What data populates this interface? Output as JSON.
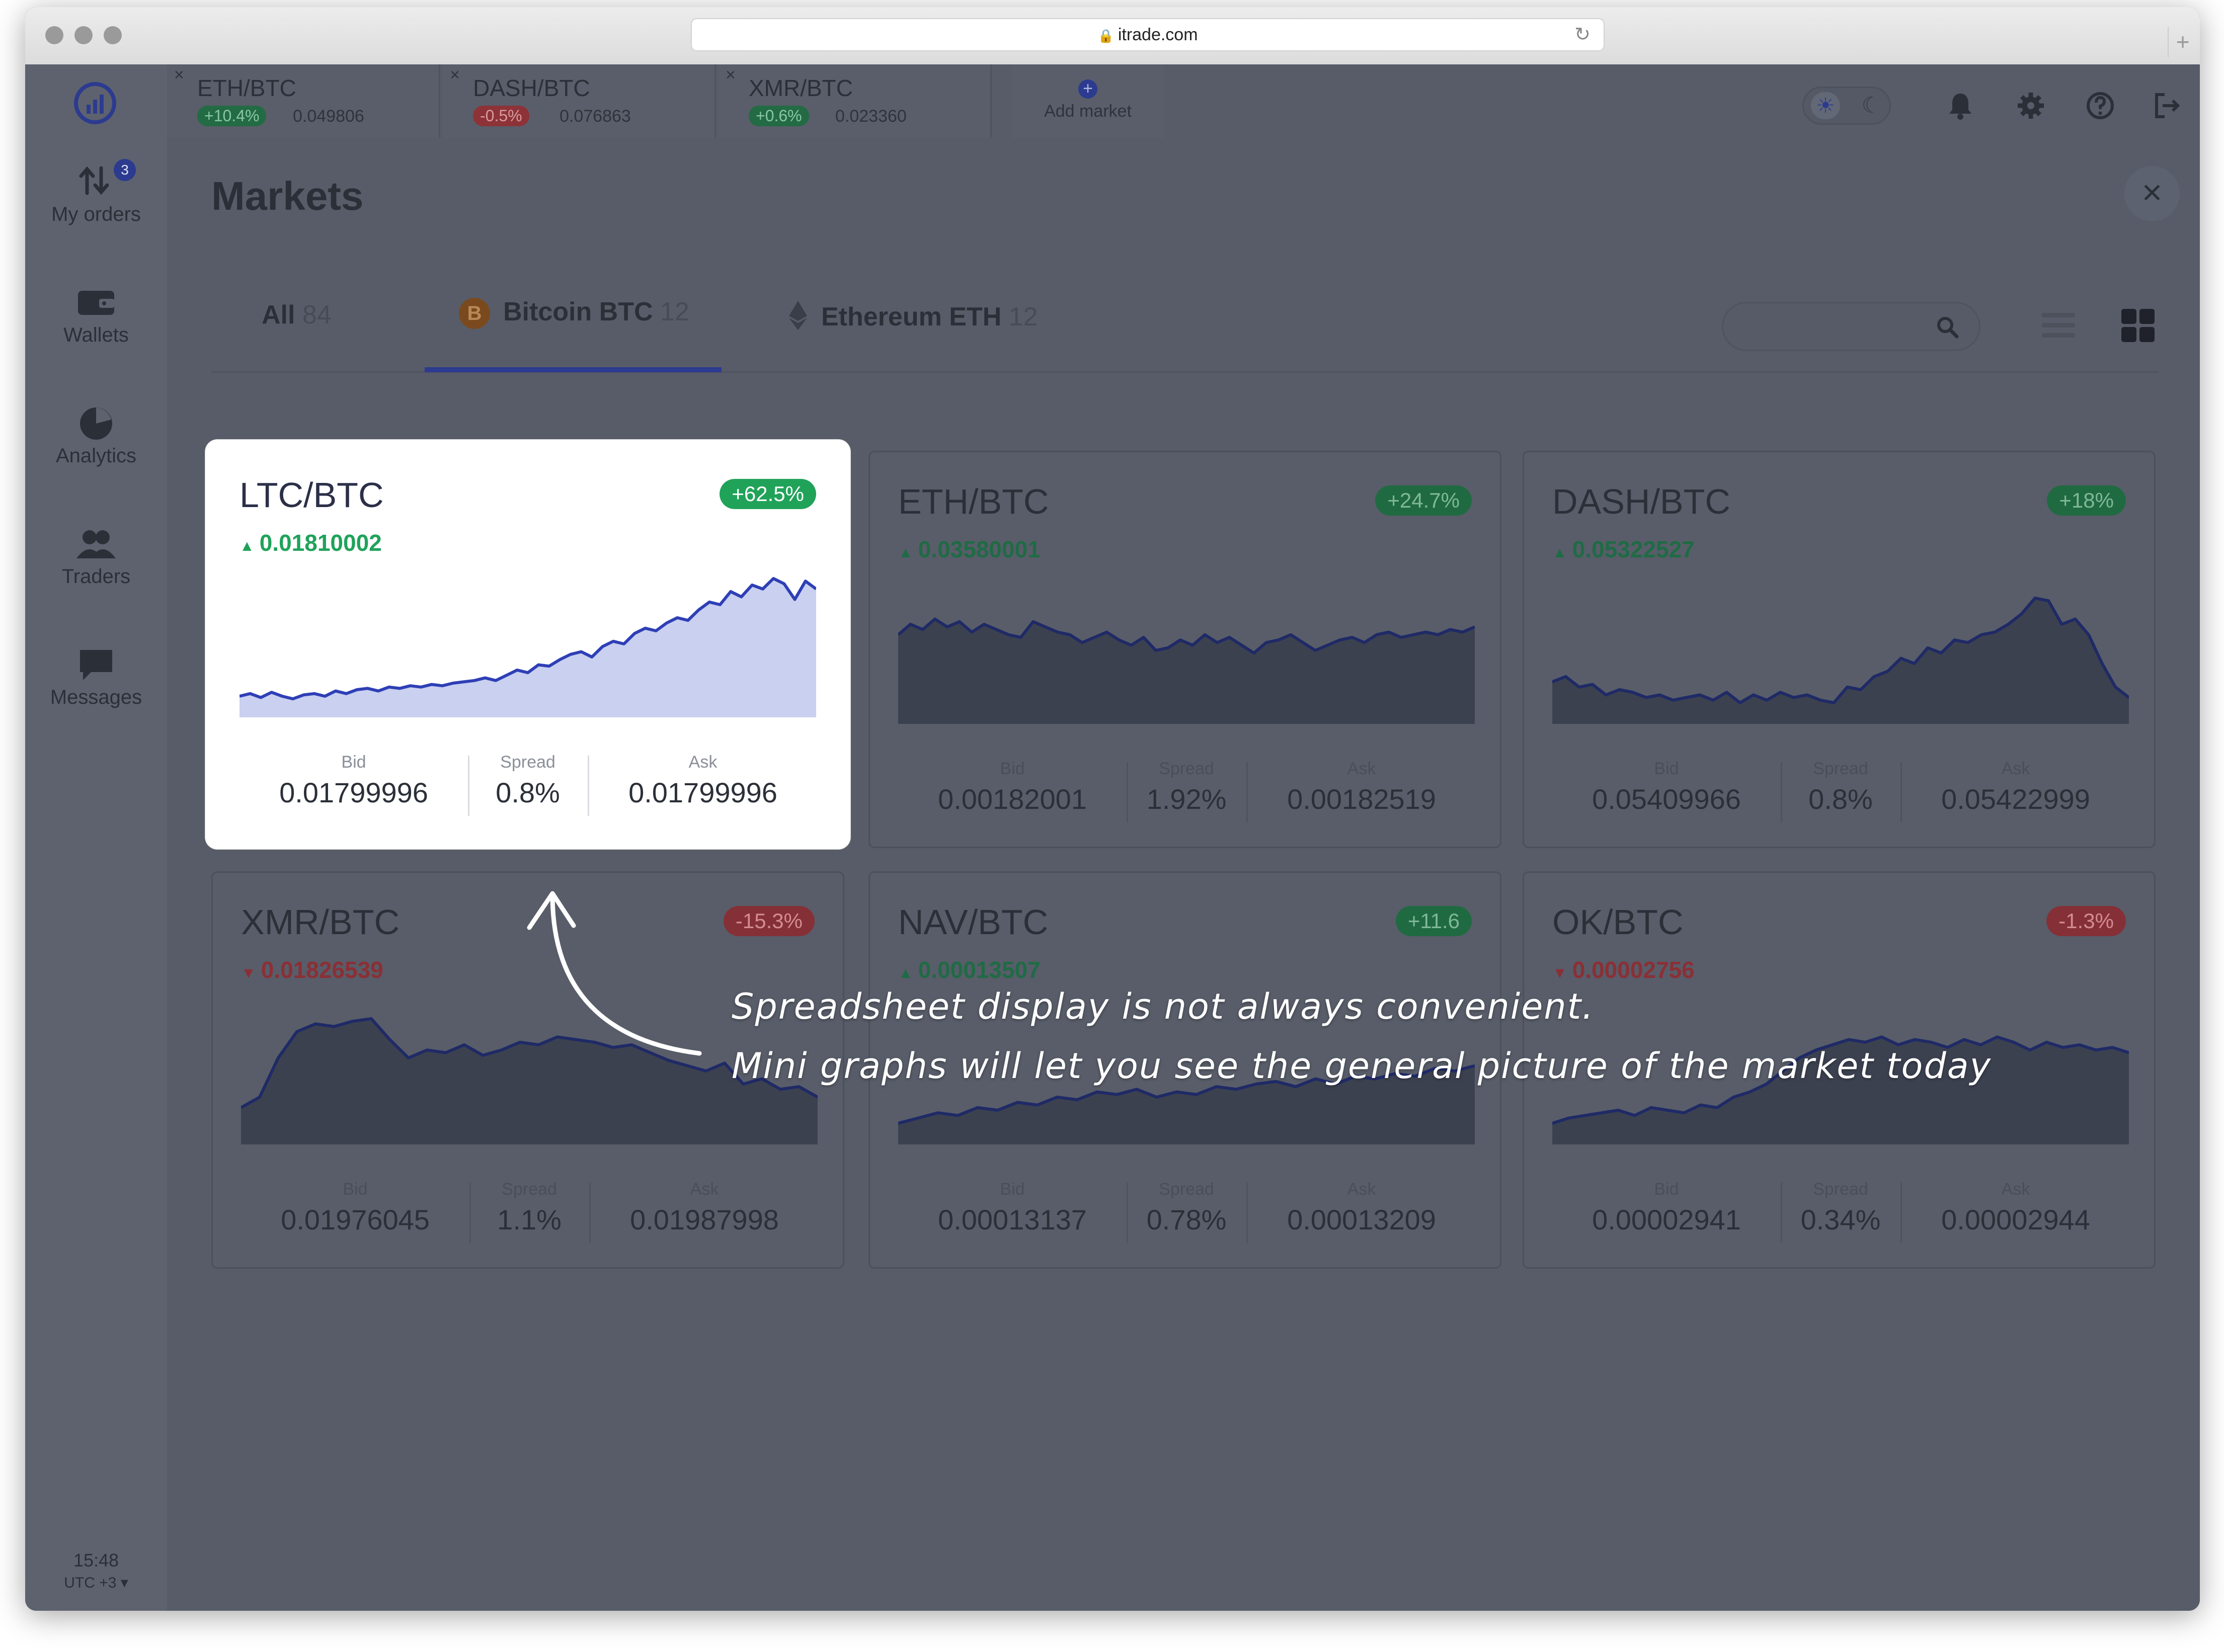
{
  "browser": {
    "url": "itrade.com"
  },
  "sidebar": {
    "items": [
      {
        "label": "My orders",
        "icon": "arrows-icon",
        "badge": "3"
      },
      {
        "label": "Wallets",
        "icon": "wallet-icon"
      },
      {
        "label": "Analytics",
        "icon": "pie-chart-icon"
      },
      {
        "label": "Traders",
        "icon": "people-icon"
      },
      {
        "label": "Messages",
        "icon": "message-icon"
      }
    ],
    "time": "15:48",
    "timezone": "UTC +3 ▾"
  },
  "topbar": {
    "tabs": [
      {
        "pair": "ETH/BTC",
        "change": "+10.4%",
        "dir": "up",
        "price": "0.049806"
      },
      {
        "pair": "DASH/BTC",
        "change": "-0.5%",
        "dir": "down",
        "price": "0.076863"
      },
      {
        "pair": "XMR/BTC",
        "change": "+0.6%",
        "dir": "up",
        "price": "0.023360"
      }
    ],
    "add_market": "Add market"
  },
  "page": {
    "title": "Markets",
    "tabs": [
      {
        "label": "All",
        "count": "84"
      },
      {
        "label": "Bitcoin BTC",
        "count": "12"
      },
      {
        "label": "Ethereum ETH",
        "count": "12"
      }
    ],
    "search_placeholder": ""
  },
  "cards": [
    {
      "pair": "LTC/BTC",
      "change": "+62.5%",
      "dir": "up",
      "last": "0.01810002",
      "bid_label": "Bid",
      "bid": "0.01799996",
      "spread_label": "Spread",
      "spread": "0.8%",
      "ask_label": "Ask",
      "ask": "0.01799996"
    },
    {
      "pair": "ETH/BTC",
      "change": "+24.7%",
      "dir": "up",
      "last": "0.03580001",
      "bid_label": "Bid",
      "bid": "0.00182001",
      "spread_label": "Spread",
      "spread": "1.92%",
      "ask_label": "Ask",
      "ask": "0.00182519"
    },
    {
      "pair": "DASH/BTC",
      "change": "+18%",
      "dir": "up",
      "last": "0.05322527",
      "bid_label": "Bid",
      "bid": "0.05409966",
      "spread_label": "Spread",
      "spread": "0.8%",
      "ask_label": "Ask",
      "ask": "0.05422999"
    },
    {
      "pair": "XMR/BTC",
      "change": "-15.3%",
      "dir": "down",
      "last": "0.01826539",
      "bid_label": "Bid",
      "bid": "0.01976045",
      "spread_label": "Spread",
      "spread": "1.1%",
      "ask_label": "Ask",
      "ask": "0.01987998"
    },
    {
      "pair": "NAV/BTC",
      "change": "+11.6",
      "dir": "up",
      "last": "0.00013507",
      "bid_label": "Bid",
      "bid": "0.00013137",
      "spread_label": "Spread",
      "spread": "0.78%",
      "ask_label": "Ask",
      "ask": "0.00013209"
    },
    {
      "pair": "OK/BTC",
      "change": "-1.3%",
      "dir": "down",
      "last": "0.00002756",
      "bid_label": "Bid",
      "bid": "0.00002941",
      "spread_label": "Spread",
      "spread": "0.34%",
      "ask_label": "Ask",
      "ask": "0.00002944"
    }
  ],
  "annotation": {
    "line1": "Spreadsheet display is not always convenient.",
    "line2": "Mini graphs will let you see the general picture of the market today"
  },
  "colors": {
    "accent": "#2c3b8f",
    "up": "#20a359",
    "down": "#853036",
    "spark_fill": "#c9d0f0",
    "spark_line": "#2e3fb6"
  }
}
